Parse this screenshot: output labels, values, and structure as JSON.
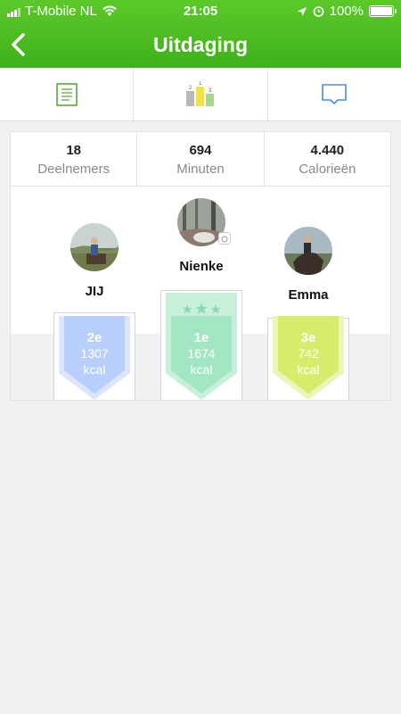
{
  "status": {
    "carrier": "T-Mobile NL",
    "time": "21:05",
    "battery": "100%"
  },
  "header": {
    "title": "Uitdaging"
  },
  "tabs": [
    {
      "name": "list",
      "icon": "document-list-icon"
    },
    {
      "name": "ranking",
      "icon": "podium-icon"
    },
    {
      "name": "chat",
      "icon": "chat-bubble-icon"
    }
  ],
  "stats": [
    {
      "value": "18",
      "label": "Deelnemers"
    },
    {
      "value": "694",
      "label": "Minuten"
    },
    {
      "value": "4.440",
      "label": "Calorieën"
    }
  ],
  "podium_icon_labels": [
    "2",
    "1",
    "3"
  ],
  "podium": {
    "second": {
      "name": "JIJ",
      "rank": "2e",
      "calories": "1307",
      "unit": "kcal",
      "color": "#b8cffb"
    },
    "first": {
      "name": "Nienke",
      "rank": "1e",
      "calories": "1674",
      "unit": "kcal",
      "color": "#a3e6c3"
    },
    "third": {
      "name": "Emma",
      "rank": "3e",
      "calories": "742",
      "unit": "kcal",
      "color": "#d9eb6b"
    }
  }
}
